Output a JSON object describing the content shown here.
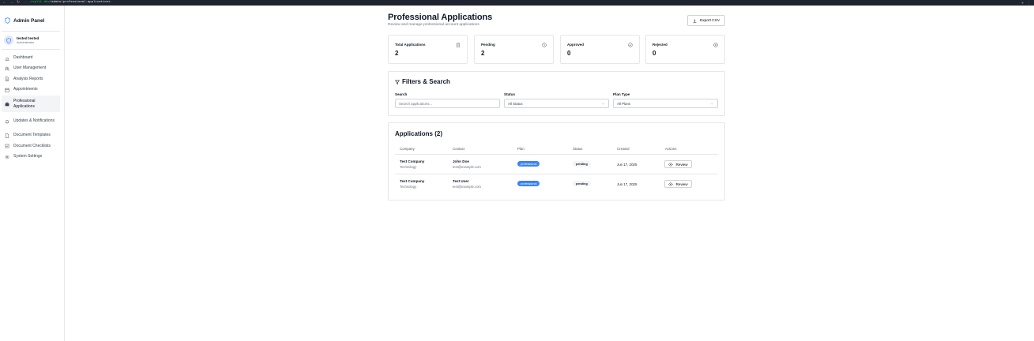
{
  "browser": {
    "url_host": "replit.dev",
    "url_path": "/admin/professional-applications",
    "url_prefix": "...-replit.dev"
  },
  "sidebar": {
    "title": "Admin Panel",
    "user": {
      "name": "tested tested",
      "role": "Administrator"
    },
    "items": [
      {
        "label": "Dashboard",
        "icon": "bar-chart-icon"
      },
      {
        "label": "User Management",
        "icon": "users-icon"
      },
      {
        "label": "Analysis Reports",
        "icon": "file-text-icon"
      },
      {
        "label": "Appointments",
        "icon": "calendar-icon"
      },
      {
        "label": "Professional Applications",
        "icon": "briefcase-icon",
        "active": true
      },
      {
        "label": "Updates & Notifications",
        "icon": "bell-icon"
      },
      {
        "label": "Document Templates",
        "icon": "file-icon"
      },
      {
        "label": "Document Checklists",
        "icon": "checklist-icon"
      },
      {
        "label": "System Settings",
        "icon": "gear-icon"
      }
    ]
  },
  "header": {
    "title": "Professional Applications",
    "subtitle": "Review and manage professional account applications",
    "export_label": "Export CSV"
  },
  "stats": [
    {
      "label": "Total Applications",
      "value": "2",
      "icon": "building-icon"
    },
    {
      "label": "Pending",
      "value": "2",
      "icon": "clock-icon"
    },
    {
      "label": "Approved",
      "value": "0",
      "icon": "check-circle-icon"
    },
    {
      "label": "Rejected",
      "value": "0",
      "icon": "x-circle-icon"
    }
  ],
  "filters": {
    "title": "Filters & Search",
    "search_label": "Search",
    "search_placeholder": "Search applications...",
    "status_label": "Status",
    "status_value": "All Status",
    "plan_label": "Plan Type",
    "plan_value": "All Plans"
  },
  "applications": {
    "title": "Applications (2)",
    "columns": [
      "Company",
      "Contact",
      "Plan",
      "Status",
      "Created",
      "Actions"
    ],
    "rows": [
      {
        "company": "Test Company",
        "industry": "Technology",
        "contact": "John Doe",
        "email": "test@example.com",
        "plan": "professional",
        "status": "pending",
        "created": "Jun 17, 2025",
        "action": "Review"
      },
      {
        "company": "Test Company",
        "industry": "Technology",
        "contact": "Test User",
        "email": "test@example.com",
        "plan": "professional",
        "status": "pending",
        "created": "Jun 17, 2025",
        "action": "Review"
      }
    ]
  },
  "colors": {
    "accent": "#3b82f6",
    "border": "#e5e7eb",
    "active_bg": "#f3f4f6"
  }
}
